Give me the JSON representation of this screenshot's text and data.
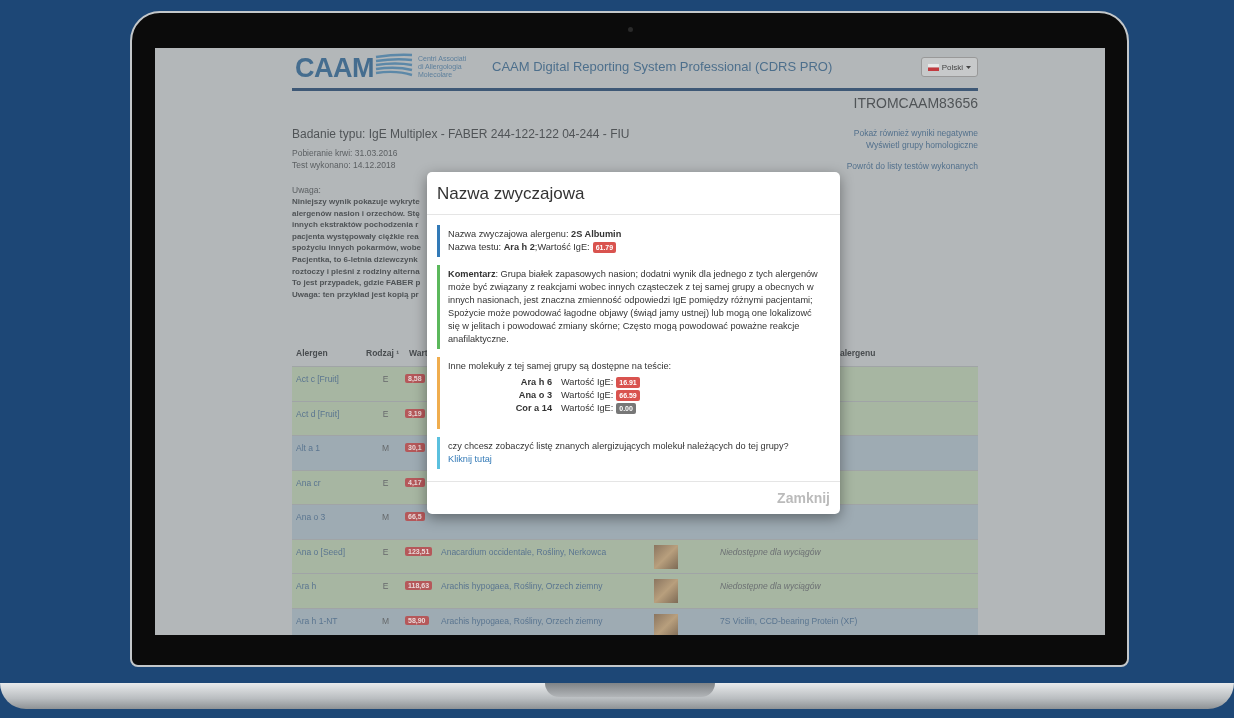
{
  "header": {
    "logo": "CAAM",
    "logo_subtitle": [
      "Centri Associati",
      "di Allergologia",
      "Molecolare"
    ],
    "title": "CAAM Digital Reporting System Professional (CDRS PRO)",
    "language": "Polski"
  },
  "patient_code": "ITROMCAAM83656",
  "test": {
    "title": "Badanie typu: IgE Multiplex - FABER 244-122-122 04-244 - FIU",
    "lines": [
      "Pobieranie krwi: 31.03.2016",
      "Test wykonano: 14.12.2018"
    ]
  },
  "links": [
    "Pokaż również wyniki negatywne",
    "Wyświetl grupy homologiczne",
    "Powrót do listy testów wykonanych"
  ],
  "note": {
    "label": "Uwaga:",
    "lines": [
      "Niniejszy wynik pokazuje wykryte",
      "alergenów nasion i orzechów. Stę",
      "innych ekstraktów pochodzenia r",
      "pacjenta występowały ciężkie rea",
      "spożyciu innych pokarmów, wobe",
      "Pacjentka, to 6-letnia dziewczynk",
      "roztoczy i pleśni z rodziny alterna",
      "To jest przypadek, gdzie FABER p",
      "Uwaga: ten przykład jest kopią pr"
    ]
  },
  "table": {
    "columns": [
      "Alergen",
      "Rodzaj ¹",
      "Wart",
      "",
      "",
      "alergenu"
    ],
    "rows": [
      {
        "kind": "partial",
        "alergen": "Act c [Fruit]",
        "rodzaj": "E",
        "value": "8,58",
        "color": "#a7b6a2"
      },
      {
        "kind": "partial",
        "alergen": "Act d [Fruit]",
        "rodzaj": "E",
        "value": "3,19",
        "color": "#a7b6a2"
      },
      {
        "kind": "partial",
        "alergen": "Alt a 1",
        "rodzaj": "M",
        "value": "30,1",
        "color": "#9eabb3"
      },
      {
        "kind": "partial",
        "alergen": "Ana cr",
        "rodzaj": "E",
        "value": "4,17",
        "color": "#a7b6a2"
      },
      {
        "kind": "partial",
        "alergen": "Ana o 3",
        "rodzaj": "M",
        "value": "66,5",
        "color": "#9eabb3"
      },
      {
        "kind": "full",
        "alergen": "Ana o [Seed]",
        "rodzaj": "E",
        "value": "123,51",
        "source": "Anacardium occidentale, Rośliny, Nerkowca",
        "description": "Niedostępne dla wyciągów",
        "italic": true,
        "color": "#a7b6a2"
      },
      {
        "kind": "full",
        "alergen": "Ara h",
        "rodzaj": "E",
        "value": "118,63",
        "source": "Arachis hypogaea, Rośliny, Orzech ziemny",
        "description": "Niedostępne dla wyciągów",
        "italic": true,
        "color": "#a7b6a2"
      },
      {
        "kind": "full",
        "alergen": "Ara h 1-NT",
        "rodzaj": "M",
        "value": "58,90",
        "source": "Arachis hypogaea, Rośliny, Orzech ziemny",
        "description": "7S Vicilin, CCD-bearing Protein (XF)",
        "italic": false,
        "color": "#9eabb3"
      }
    ]
  },
  "modal": {
    "title": "Nazwa zwyczajowa",
    "sections": [
      {
        "kind": "name",
        "color": "#337ab7",
        "lines": [
          "Nazwa zwyczajowa alergenu: **2S Albumin**",
          "Nazwa testu: **Ara h 2**;Wartość IgE:"
        ],
        "badge": {
          "text": "61.79",
          "color": "#d9534f"
        }
      },
      {
        "kind": "comment",
        "color": "#5cb85c",
        "text": "**Komentarz**: Grupa białek zapasowych nasion; dodatni wynik dla jednego z tych alergenów może być związany z reakcjami wobec innych cząsteczek z tej samej grupy a obecnych w innych nasionach, jest znaczna zmienność odpowiedzi IgE pomiędzy różnymi pacjentami; Spożycie może powodować łagodne objawy (świąd jamy ustnej) lub mogą one lokalizowć się w jelitach i powodować zmiany skórne; Często mogą powodować poważne reakcje anafilaktyczne."
      },
      {
        "kind": "molecules",
        "color": "#f0ad4e",
        "text": "Inne molekuły z tej samej grupy są dostępne na teście:",
        "items": [
          {
            "name": "Ara h 6",
            "label": "Wartość IgE:",
            "value": "16.91",
            "color": "#d9534f"
          },
          {
            "name": "Ana o 3",
            "label": "Wartość IgE:",
            "value": "66.59",
            "color": "#d9534f"
          },
          {
            "name": "Cor a 14",
            "label": "Wartość IgE:",
            "value": "0.00",
            "color": "#777777"
          }
        ]
      },
      {
        "kind": "link",
        "color": "#5bc0de",
        "text": "czy chcesz zobaczyć listę znanych alergizujących molekuł należących do tej grupy?",
        "link": "Kliknij tutaj"
      }
    ],
    "close": "Zamknij"
  }
}
